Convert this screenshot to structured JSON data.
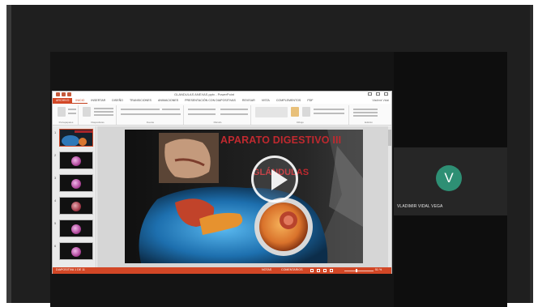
{
  "meeting": {
    "participant": {
      "initial": "V",
      "name": "VLADIMIR VIDAL VEGA",
      "avatar_color": "#2e8f74"
    }
  },
  "powerpoint": {
    "window_title": "GLANDULAS ANEXAS.pptx - PowerPoint",
    "user_account": "Vladimir Vidal",
    "accent_color": "#d24726",
    "tabs": [
      "ARCHIVO",
      "INICIO",
      "INSERTAR",
      "DISEÑO",
      "TRANSICIONES",
      "ANIMACIONES",
      "PRESENTACIÓN CON DIAPOSITIVAS",
      "REVISAR",
      "VISTA",
      "COMPLEMENTOS",
      "PDF"
    ],
    "ribbon_groups": [
      "Portapapeles",
      "Diapositivas",
      "Fuente",
      "Párrafo",
      "Dibujo",
      "Edición"
    ],
    "thumbnails": [
      "1",
      "2",
      "3",
      "4",
      "5",
      "6"
    ],
    "selected_slide": 1,
    "slide": {
      "title": "APARATO DIGESTIVO III",
      "subtitle": "GLÁNDULAS",
      "title_color": "#c0292f"
    },
    "status": {
      "slide_counter": "DIAPOSITIVA 1 DE 11",
      "notes": "NOTAS",
      "comments": "COMENTARIOS",
      "zoom": "51 %"
    }
  }
}
